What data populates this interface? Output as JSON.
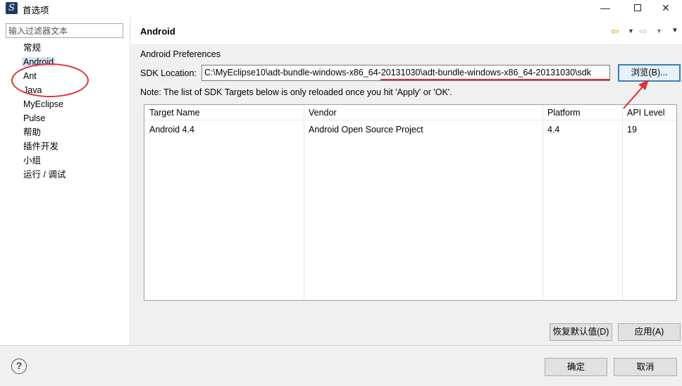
{
  "window": {
    "title": "首选项",
    "app_icon_glyph": "℘",
    "minimize_glyph": "—",
    "close_glyph": "✕"
  },
  "sidebar": {
    "filter_placeholder": "输入过滤器文本",
    "items": [
      {
        "label": "常规"
      },
      {
        "label": "Android",
        "selected": true
      },
      {
        "label": "Ant"
      },
      {
        "label": "Java"
      },
      {
        "label": "MyEclipse"
      },
      {
        "label": "Pulse"
      },
      {
        "label": "帮助"
      },
      {
        "label": "插件开发"
      },
      {
        "label": "小组"
      },
      {
        "label": "运行 / 调试"
      }
    ]
  },
  "page": {
    "title": "Android",
    "section_label": "Android Preferences",
    "sdk_location_label": "SDK Location:",
    "sdk_location_value": "C:\\MyEclipse10\\adt-bundle-windows-x86_64-20131030\\adt-bundle-windows-x86_64-20131030\\sdk",
    "browse_label": "浏览(B)...",
    "note": "Note: The list of SDK Targets below is only reloaded once you hit 'Apply' or 'OK'.",
    "table": {
      "columns": [
        "Target Name",
        "Vendor",
        "Platform",
        "API Level"
      ],
      "rows": [
        [
          "Android 4.4",
          "Android Open Source Project",
          "4.4",
          "19"
        ]
      ]
    },
    "restore_defaults_label": "恢复默认值(D)",
    "apply_label": "应用(A)"
  },
  "nav_icons": {
    "back_glyph": "⇦",
    "forward_glyph": "⇨",
    "dropdown_glyph": "▼"
  },
  "footer": {
    "help_glyph": "?",
    "ok_label": "确定",
    "cancel_label": "取消"
  },
  "annotation_color": "#e0303a",
  "selection_color": "#d7e4f5"
}
